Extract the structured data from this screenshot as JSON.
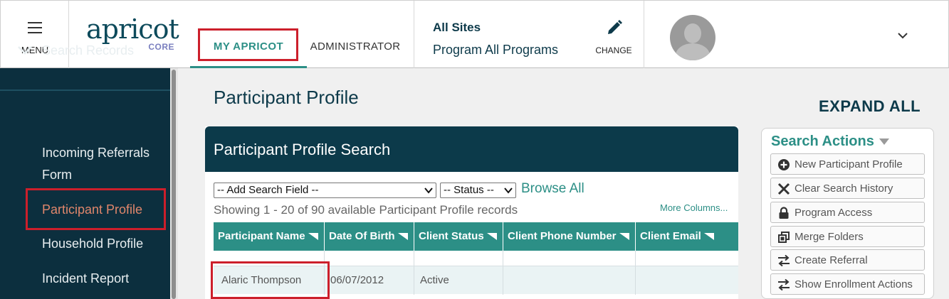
{
  "topbar": {
    "menu_label": "MENU",
    "logo_text": "apricot",
    "logo_sub": "CORE",
    "tab_my": "MY APRICOT",
    "tab_admin": "ADMINISTRATOR",
    "sites_title": "All Sites",
    "sites_program": "Program All Programs",
    "change_label": "CHANGE"
  },
  "sidebar": {
    "section": "Search Records",
    "items": [
      {
        "line1": "Incoming Referrals",
        "line2": "Form"
      },
      {
        "line1": "Participant Profile"
      },
      {
        "line1": "Household Profile"
      },
      {
        "line1": "Incident Report"
      }
    ]
  },
  "main": {
    "title": "Participant Profile",
    "expand_all": "EXPAND ALL",
    "panel_title": "Participant Profile Search",
    "add_field": "-- Add Search Field --",
    "status": "-- Status --",
    "browse_all": "Browse All",
    "showing": "Showing 1 - 20 of 90 available Participant Profile records",
    "more_columns": "More Columns...",
    "columns": [
      "Participant Name",
      "Date Of Birth",
      "Client Status",
      "Client Phone Number",
      "Client Email"
    ],
    "rows": [
      {
        "name": "Alaric Thompson",
        "dob": "06/07/2012",
        "status": "Active",
        "phone": "",
        "email": ""
      }
    ]
  },
  "actions": {
    "title": "Search Actions",
    "items": [
      {
        "label": "New Participant Profile",
        "icon": "plus-circle-icon"
      },
      {
        "label": "Clear Search History",
        "icon": "x-icon"
      },
      {
        "label": "Program Access",
        "icon": "lock-icon"
      },
      {
        "label": "Merge Folders",
        "icon": "merge-icon"
      },
      {
        "label": "Create Referral",
        "icon": "swap-arrows-icon"
      },
      {
        "label": "Show Enrollment Actions",
        "icon": "swap-arrows-icon"
      }
    ]
  },
  "colors": {
    "navy": "#0c2f3e",
    "teal": "#2c8f86",
    "highlight": "#cc1f2b",
    "active_item": "#e0866b"
  }
}
